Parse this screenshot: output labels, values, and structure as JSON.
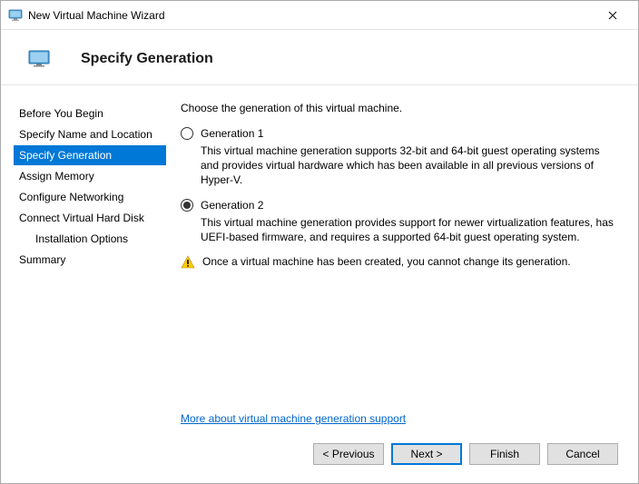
{
  "titlebar": {
    "title": "New Virtual Machine Wizard"
  },
  "header": {
    "title": "Specify Generation"
  },
  "sidebar": {
    "items": [
      {
        "label": "Before You Begin"
      },
      {
        "label": "Specify Name and Location"
      },
      {
        "label": "Specify Generation"
      },
      {
        "label": "Assign Memory"
      },
      {
        "label": "Configure Networking"
      },
      {
        "label": "Connect Virtual Hard Disk"
      },
      {
        "label": "Installation Options"
      },
      {
        "label": "Summary"
      }
    ]
  },
  "content": {
    "intro": "Choose the generation of this virtual machine.",
    "gen1": {
      "label": "Generation 1",
      "desc": "This virtual machine generation supports 32-bit and 64-bit guest operating systems and provides virtual hardware which has been available in all previous versions of Hyper-V."
    },
    "gen2": {
      "label": "Generation 2",
      "desc": "This virtual machine generation provides support for newer virtualization features, has UEFI-based firmware, and requires a supported 64-bit guest operating system."
    },
    "warning": "Once a virtual machine has been created, you cannot change its generation.",
    "link": "More about virtual machine generation support"
  },
  "buttons": {
    "previous": "< Previous",
    "next": "Next >",
    "finish": "Finish",
    "cancel": "Cancel"
  }
}
